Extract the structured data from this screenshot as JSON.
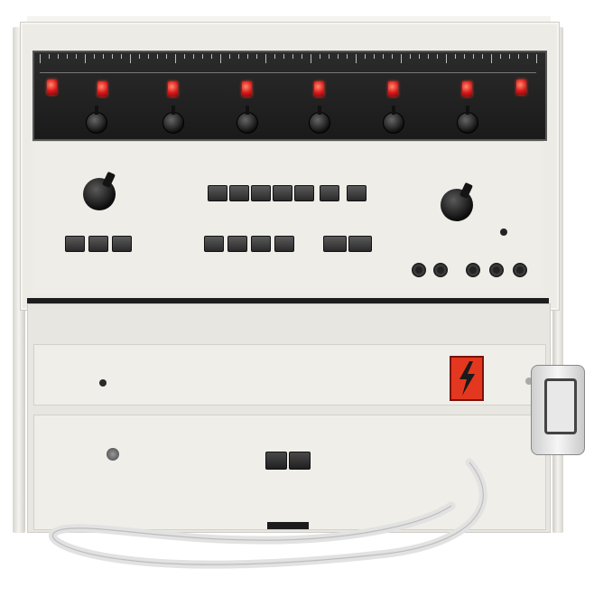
{
  "photo": {
    "colors": {
      "cabinet": "#ecebe6",
      "display_bezel": "#1a1a1a",
      "lamp": "#d8161a",
      "warning_plate": "#e3381f",
      "cable": "#e8e8e8"
    },
    "warning_plate_icon": "lightning-bolt-icon"
  }
}
